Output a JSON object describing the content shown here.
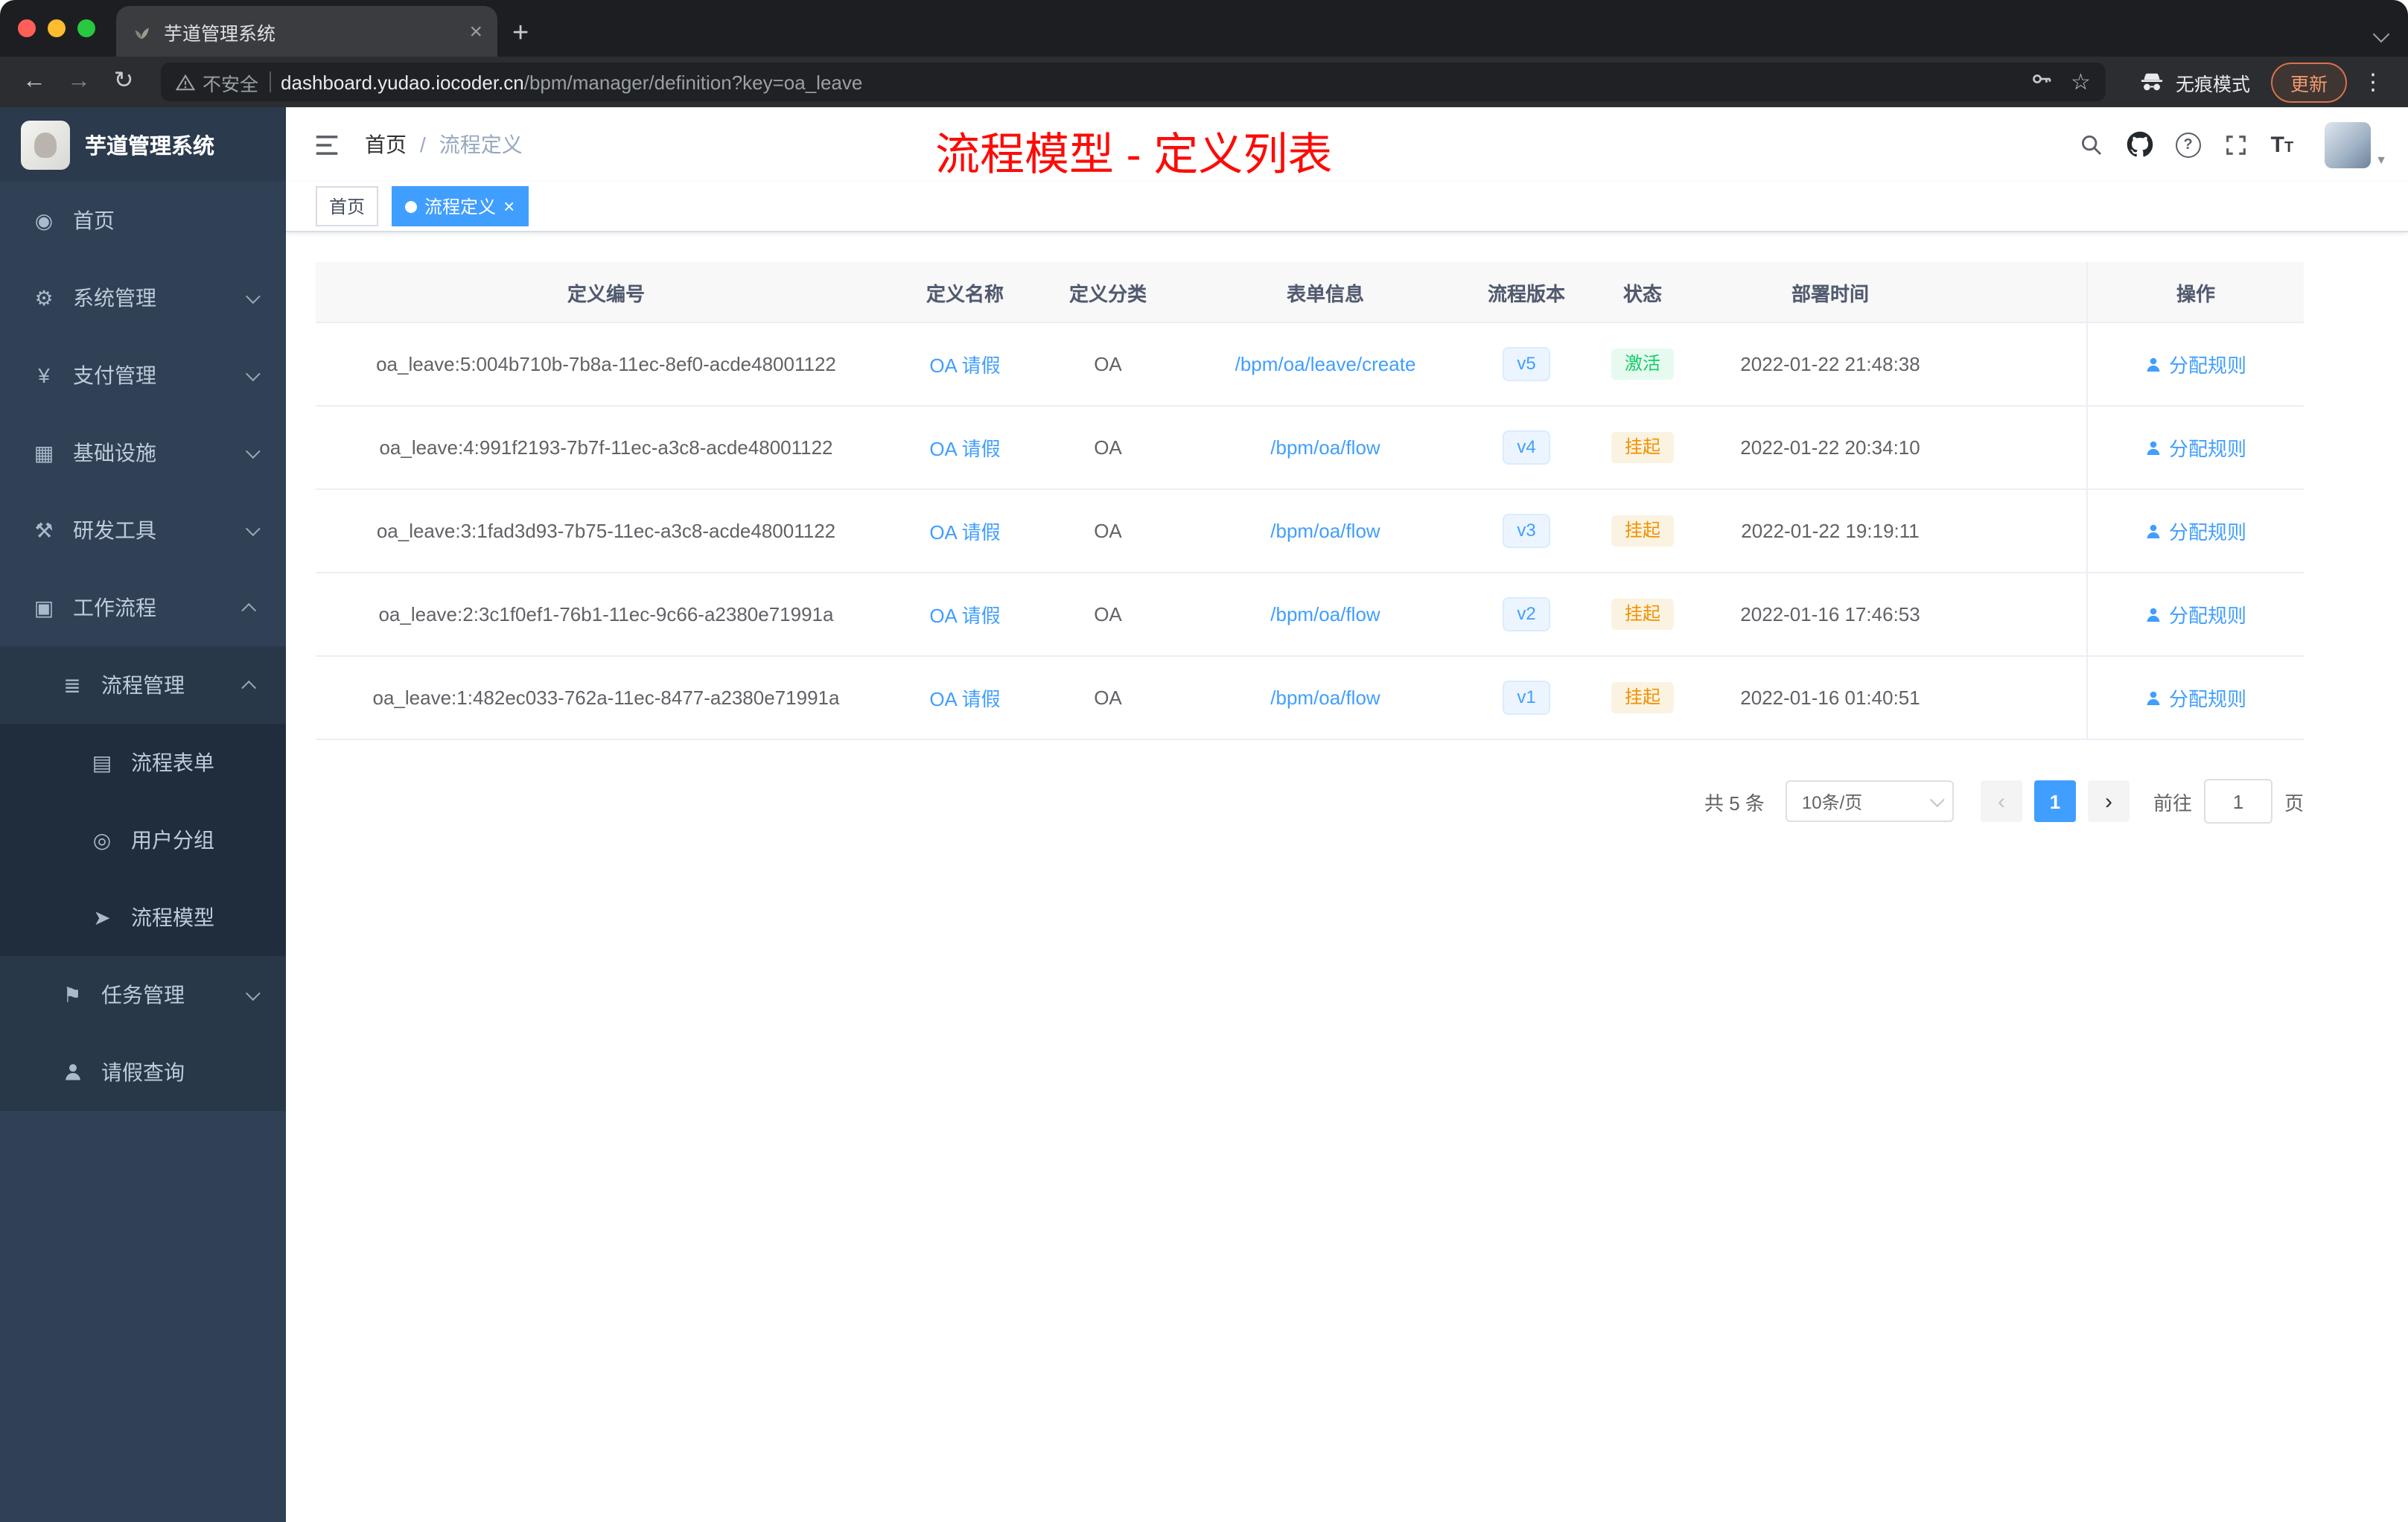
{
  "browser": {
    "tab": {
      "title": "芋道管理系统"
    },
    "address": {
      "security_label": "不安全",
      "url_host": "dashboard.yudao.iocoder.cn",
      "url_path": "/bpm/manager/definition?key=oa_leave",
      "incognito_label": "无痕模式",
      "update_label": "更新"
    }
  },
  "sidebar": {
    "logo_title": "芋道管理系统",
    "menu": [
      {
        "label": "首页",
        "icon": "dashboard-icon",
        "level": 1
      },
      {
        "label": "系统管理",
        "icon": "gear-icon",
        "level": 1,
        "chevron": "down"
      },
      {
        "label": "支付管理",
        "icon": "yen-icon",
        "level": 1,
        "chevron": "down"
      },
      {
        "label": "基础设施",
        "icon": "infra-icon",
        "level": 1,
        "chevron": "down"
      },
      {
        "label": "研发工具",
        "icon": "tools-icon",
        "level": 1,
        "chevron": "down"
      },
      {
        "label": "工作流程",
        "icon": "briefcase-icon",
        "level": 1,
        "chevron": "up"
      },
      {
        "label": "流程管理",
        "icon": "list-icon",
        "level": 2,
        "chevron": "up"
      },
      {
        "label": "流程表单",
        "icon": "form-icon",
        "level": 3
      },
      {
        "label": "用户分组",
        "icon": "users-icon",
        "level": 3
      },
      {
        "label": "流程模型",
        "icon": "send-icon",
        "level": 3
      },
      {
        "label": "任务管理",
        "icon": "task-icon",
        "level": 2,
        "chevron": "down"
      },
      {
        "label": "请假查询",
        "icon": "person-icon",
        "level": 2
      }
    ]
  },
  "navbar": {
    "breadcrumb": {
      "home": "首页",
      "separator": "/",
      "current": "流程定义"
    },
    "annotation": "流程模型 - 定义列表",
    "icons": [
      "search-icon",
      "github-icon",
      "help-icon",
      "fullscreen-icon",
      "font-size-icon"
    ]
  },
  "tags": [
    {
      "label": "首页",
      "active": false,
      "closable": false
    },
    {
      "label": "流程定义",
      "active": true,
      "closable": true
    }
  ],
  "table": {
    "columns": [
      "定义编号",
      "定义名称",
      "定义分类",
      "表单信息",
      "流程版本",
      "状态",
      "部署时间",
      "操作"
    ],
    "rows": [
      {
        "id": "oa_leave:5:004b710b-7b8a-11ec-8ef0-acde48001122",
        "name": "OA 请假",
        "category": "OA",
        "form": "/bpm/oa/leave/create",
        "version": "v5",
        "status": "激活",
        "status_type": "active",
        "deployed_at": "2022-01-22 21:48:38",
        "action": "分配规则"
      },
      {
        "id": "oa_leave:4:991f2193-7b7f-11ec-a3c8-acde48001122",
        "name": "OA 请假",
        "category": "OA",
        "form": "/bpm/oa/flow",
        "version": "v4",
        "status": "挂起",
        "status_type": "suspended",
        "deployed_at": "2022-01-22 20:34:10",
        "action": "分配规则"
      },
      {
        "id": "oa_leave:3:1fad3d93-7b75-11ec-a3c8-acde48001122",
        "name": "OA 请假",
        "category": "OA",
        "form": "/bpm/oa/flow",
        "version": "v3",
        "status": "挂起",
        "status_type": "suspended",
        "deployed_at": "2022-01-22 19:19:11",
        "action": "分配规则"
      },
      {
        "id": "oa_leave:2:3c1f0ef1-76b1-11ec-9c66-a2380e71991a",
        "name": "OA 请假",
        "category": "OA",
        "form": "/bpm/oa/flow",
        "version": "v2",
        "status": "挂起",
        "status_type": "suspended",
        "deployed_at": "2022-01-16 17:46:53",
        "action": "分配规则"
      },
      {
        "id": "oa_leave:1:482ec033-762a-11ec-8477-a2380e71991a",
        "name": "OA 请假",
        "category": "OA",
        "form": "/bpm/oa/flow",
        "version": "v1",
        "status": "挂起",
        "status_type": "suspended",
        "deployed_at": "2022-01-16 01:40:51",
        "action": "分配规则"
      }
    ]
  },
  "pagination": {
    "total": "共 5 条",
    "page_size": "10条/页",
    "pages": [
      "1"
    ],
    "goto_label": "前往",
    "goto_value": "1",
    "unit_label": "页"
  },
  "colors": {
    "accent": "#409eff",
    "annotation_red": "#fd0b07",
    "status_active_text": "#13ce66",
    "status_suspended_text": "#f29100",
    "sidebar_bg": "#304156"
  }
}
